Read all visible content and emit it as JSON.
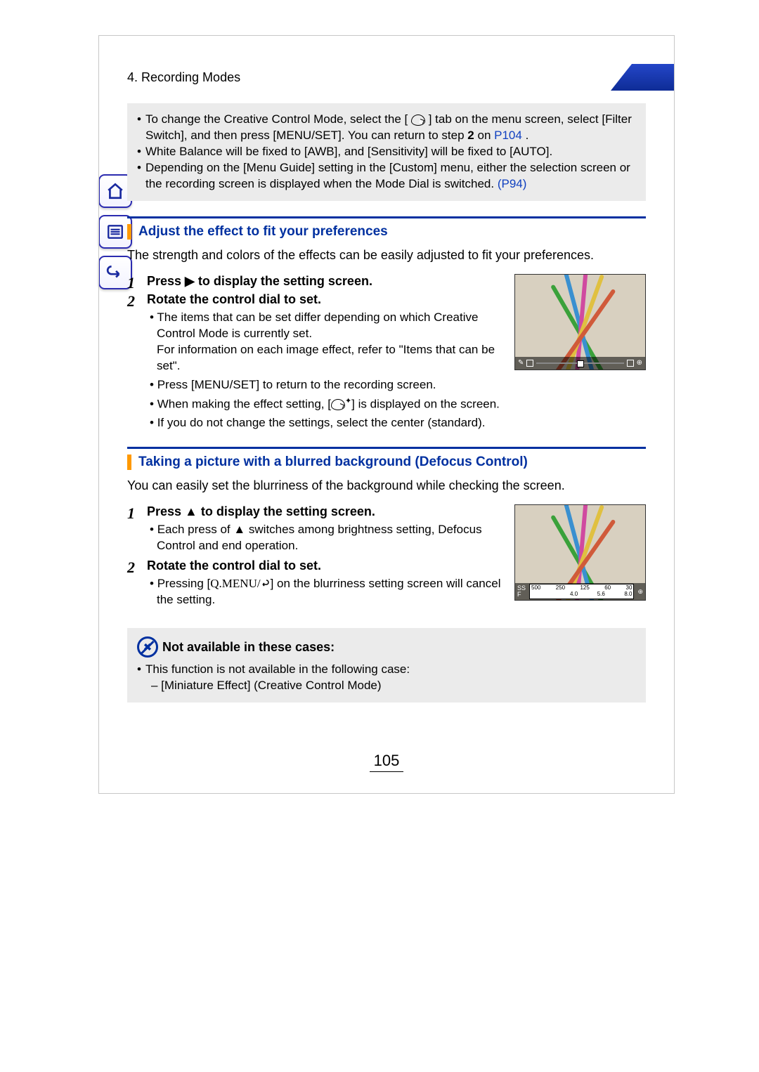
{
  "header": {
    "breadcrumb": "4. Recording Modes"
  },
  "notes_box": {
    "n1a": "To change the Creative Control Mode, select the [",
    "n1b": "] tab on the menu screen, select [Filter Switch], and then press [MENU/SET]. You can return to step ",
    "n1_step": "2",
    "n1_on": " on ",
    "n1_link": "P104",
    "n1_dot": ".",
    "n2": "White Balance will be fixed to [AWB], and [Sensitivity] will be fixed to [AUTO].",
    "n3a": "Depending on the [Menu Guide] setting in the [Custom] menu, either the selection screen or the recording screen is displayed when the Mode Dial is switched. ",
    "n3_link": "(P94)"
  },
  "section1": {
    "title": "Adjust the effect to fit your preferences",
    "intro": "The strength and colors of the effects can be easily adjusted to fit your preferences.",
    "step1": "Press ▶ to display the setting screen.",
    "step2": "Rotate the control dial to set.",
    "b1a": "The items that can be set differ depending on which Creative Control Mode is currently set.",
    "b1b": "For information on each image effect, refer to \"Items that can be set\".",
    "b2": "Press [MENU/SET] to return to the recording screen.",
    "b3a": "When making the effect setting, [",
    "b3b": "] is displayed on the screen.",
    "b4": "If you do not change the settings, select the center (standard)."
  },
  "section2": {
    "title": "Taking a picture with a blurred background (Defocus Control)",
    "intro": "You can easily set the blurriness of the background while checking the screen.",
    "step1": "Press ▲ to display the setting screen.",
    "s1b": "Each press of ▲ switches among brightness setting, Defocus Control and end operation.",
    "step2": "Rotate the control dial to set.",
    "s2b_a": "Pressing [",
    "s2b_q": "Q.MENU/",
    "s2b_b": "] on the blurriness setting screen will cancel the setting."
  },
  "not_available": {
    "title": "Not available in these cases:",
    "l1": "This function is not available in the following case:",
    "l2": "– [Miniature Effect] (Creative Control Mode)"
  },
  "chart_data": {
    "type": "table",
    "title": "Defocus control scale overlay",
    "series": [
      {
        "name": "SS",
        "values": [
          500,
          250,
          125,
          60,
          30
        ]
      },
      {
        "name": "F",
        "values": [
          null,
          null,
          4.0,
          5.6,
          8.0
        ]
      }
    ]
  },
  "page_number": "105"
}
